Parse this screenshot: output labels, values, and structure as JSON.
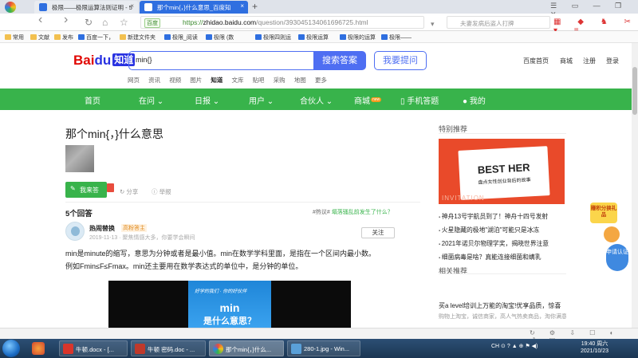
{
  "browser": {
    "tabs": [
      {
        "title": "极限——极限运算法则证明 - 5"
      },
      {
        "title": "那个min{，}什么意思_百度知"
      }
    ],
    "new_tab_glyph": "+",
    "nav": {
      "back": "‹",
      "forward": "›",
      "refresh": "↻",
      "home": "⌂",
      "star": "☆"
    },
    "address": {
      "badge": "百度",
      "url_prefix": "https://",
      "url_host": "zhidao.baidu.com",
      "url_path": "/question/393045134061696725.html"
    },
    "side_search": "夫妻发病后盗人打牌",
    "bookmarks": [
      "常用",
      "文献",
      "发布",
      "百度一下，",
      "新建文件夹",
      "极限_阅读",
      "极限 (数",
      "极限四则运",
      "极限运算",
      "极限的运算",
      "极限——"
    ]
  },
  "header": {
    "logo_text": "Bai",
    "logo_du": "du",
    "logo_zhidao": "知道",
    "query": "min{}",
    "search_btn": "搜索答案",
    "ask_btn": "我要提问",
    "links": [
      "百度首页",
      "商城",
      "注册",
      "登录"
    ],
    "subnav": [
      "网页",
      "资讯",
      "视频",
      "图片",
      "知道",
      "文库",
      "贴吧",
      "采购",
      "地图",
      "更多"
    ],
    "subnav_active": "知道"
  },
  "greenbar": {
    "items": [
      "首页",
      "在问",
      "日报",
      "用户",
      "合伙人",
      "商城",
      "手机答题",
      "我的"
    ],
    "new_badge": "new"
  },
  "question": {
    "title": "那个min{，}什么意思",
    "answer_btn": "我来答",
    "share": "分享",
    "report": "举报"
  },
  "answers": {
    "count_label": "5个回答",
    "hot_prefix": "#热议#",
    "hot_topic": "塌落骚乱前发生了什么？",
    "user_name": "热闹替换",
    "user_badge": "高粉答主",
    "meta": "2019-11-13 · 聚焦情感大多，你要学会瞬间",
    "follow": "关注",
    "text_line1": "min是minute的缩写，意思为分钟或者是最小值。min在数学学科里面，是指在一个区间内最小数。",
    "text_line2": "例如Fmin≤F≤Fmax。min还主要用在数学表达式的单位中，是分钟的单位。",
    "video_top": "好学的我们 · 你的好伙伴",
    "video_word": "min",
    "video_question": "是什么意思？"
  },
  "sidebar": {
    "title": "特别推荐",
    "banner_title": "BEST HER",
    "banner_sub": "盘点女性创业背后的故事",
    "banner_watermark": "INVITATION",
    "news": [
      "神舟13号宇航员到了！神舟十四号发射",
      "火星隐藏的极地\"湖泊\"可能只是冰冻",
      "2021年诺贝尔物理学奖，揭晓世界注意",
      "细菌病毒是啥？真能连接细菌和螨乳"
    ],
    "related_title": "相关推荐",
    "related_item": "买a level培训上万能的淘宝!优享品质，惊喜",
    "related_sub": "购物上淘宝，诚信商家，高人气热卖商品，淘你满意"
  },
  "floating": {
    "badge": "赚积分换礼品",
    "apply": "申请认证"
  },
  "taskbar": {
    "tasks": [
      "牛顿.docx - [...",
      "牛顿 密码.doc - ...",
      "那个min{，}什么...",
      "280-1.jpg - Win..."
    ],
    "tray": "CH  ⊙ ?  ▲ ⊕ ⚑ ◀)",
    "time": "19:40 周六",
    "date": "2021/10/23"
  },
  "colors": {
    "green": "#38b34b",
    "blue": "#4e6ef2",
    "red": "#e10601"
  }
}
